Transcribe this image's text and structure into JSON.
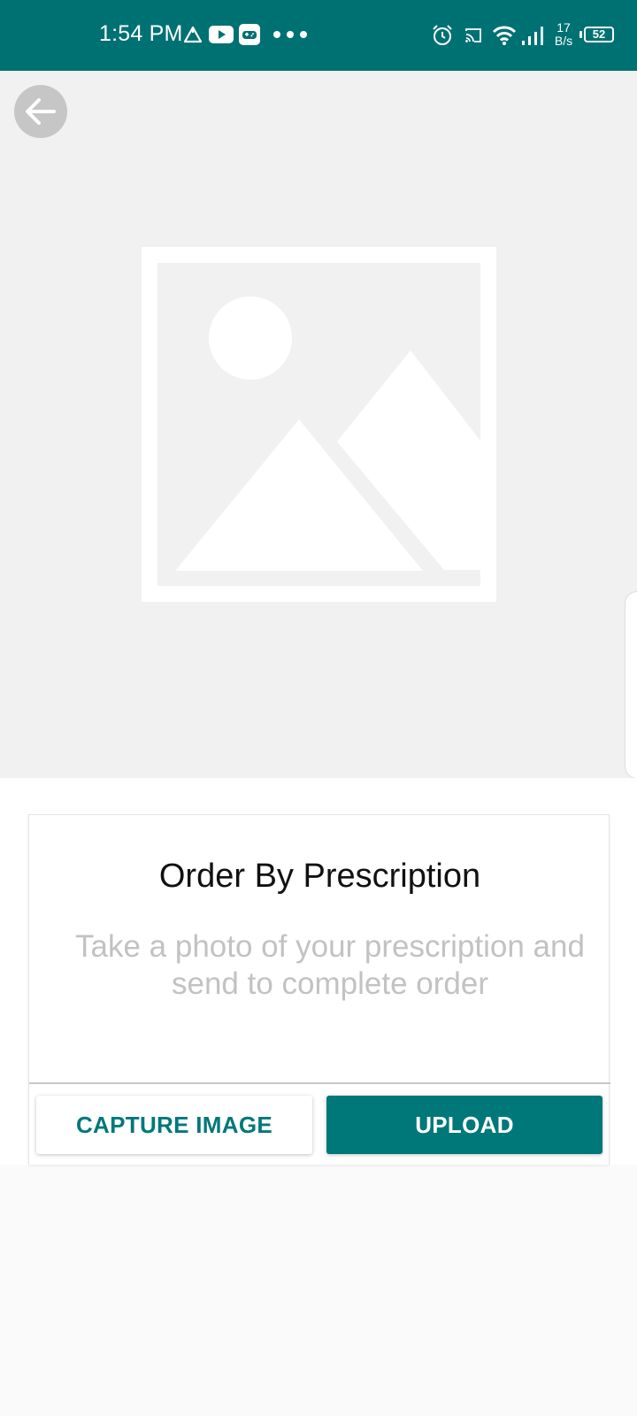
{
  "status_bar": {
    "time": "1:54 PM",
    "net_speed_value": "17",
    "net_speed_unit": "B/s",
    "battery_level": "52",
    "icons": [
      "warning-triangle-icon",
      "youtube-icon",
      "game-controller-icon",
      "more-dots-icon",
      "alarm-icon",
      "cast-icon",
      "wifi-icon",
      "signal-icon",
      "battery-icon"
    ]
  },
  "preview": {
    "back_icon": "arrow-left-icon",
    "placeholder_icon": "image-placeholder-icon"
  },
  "card": {
    "title": "Order By Prescription",
    "description": "Take a photo of your prescription and send to complete order",
    "capture_label": "CAPTURE IMAGE",
    "upload_label": "UPLOAD"
  },
  "colors": {
    "primary": "#007173",
    "button_primary": "#00787a",
    "preview_background": "#f1f1f1",
    "description_text": "#c2c2c2"
  }
}
